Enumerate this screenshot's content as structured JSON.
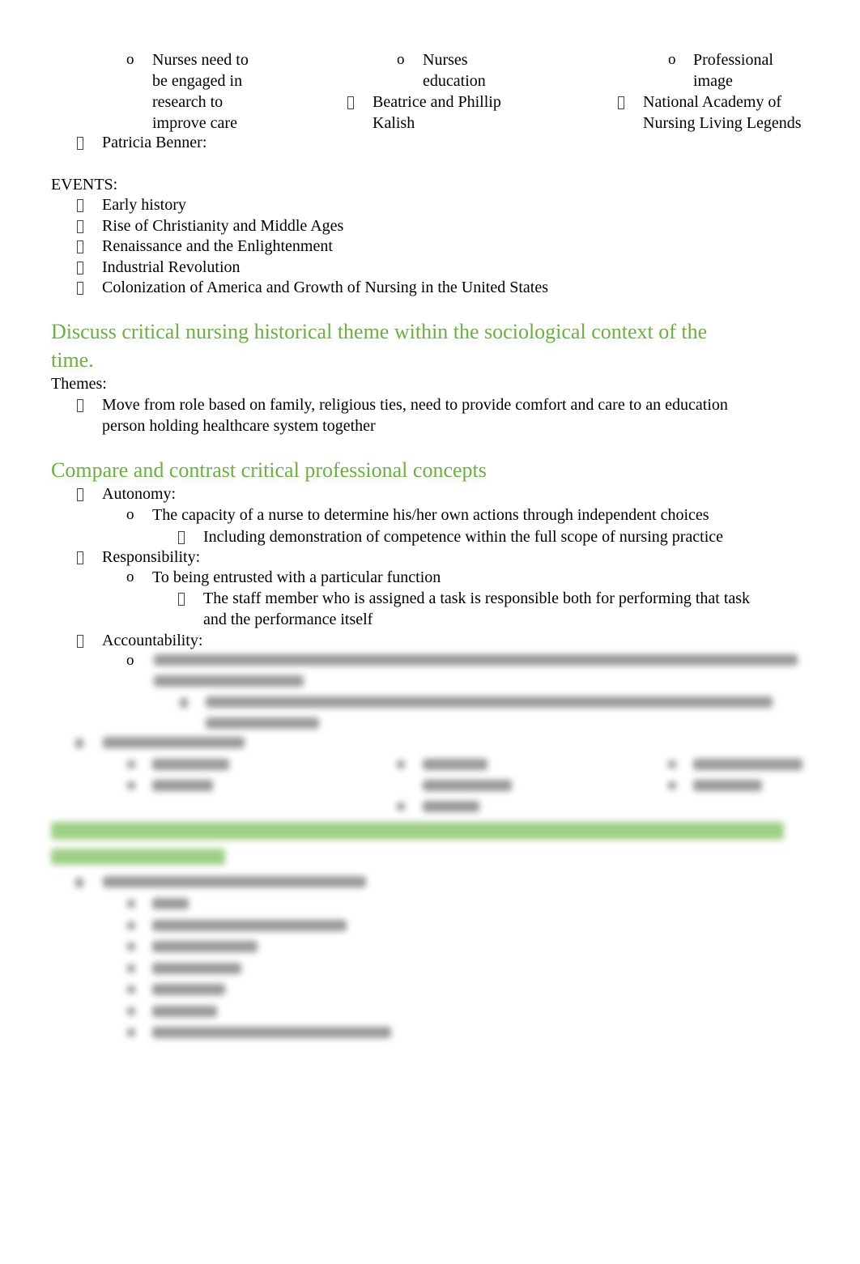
{
  "bullet_glyph": "square-missing-glyph",
  "heading_color": "#70ad47",
  "top_columns": {
    "col1_sub": [
      "Nurses need to",
      "be engaged in",
      "research to",
      "improve care"
    ],
    "col2_sub": [
      "Nurses",
      "education"
    ],
    "col2_item": [
      "Beatrice and Phillip",
      "Kalish"
    ],
    "col3_sub": [
      "Professional",
      "image"
    ],
    "col3_item": [
      "National Academy of",
      "Nursing Living Legends"
    ],
    "sub_marker": "o",
    "patricia": "Patricia Benner:"
  },
  "events": {
    "label": "EVENTS:",
    "items": [
      "Early history",
      "Rise of Christianity and Middle Ages",
      "Renaissance and the Enlightenment",
      "Industrial Revolution",
      "Colonization of America and Growth of Nursing in the United States"
    ]
  },
  "section1": {
    "heading": [
      "Discuss critical nursing historical theme within the sociological context of the",
      "time."
    ],
    "label": "Themes:",
    "item": [
      "Move from role based on family, religious ties, need to provide comfort and care to an education",
      "person holding healthcare system together"
    ]
  },
  "section2": {
    "heading": "Compare and contrast critical professional concepts",
    "autonomy": "Autonomy:",
    "autonomy_sub": "The capacity of a nurse to determine his/her own actions through independent choices",
    "autonomy_sub2": "Including demonstration of competence within the full scope of nursing practice",
    "responsibility": "Responsibility:",
    "responsibility_sub": "To being entrusted with a particular function",
    "responsibility_sub2": [
      "The staff member who is assigned a task is responsible  both for performing that task",
      "and the performance itself"
    ],
    "accountability": "Accountability:"
  }
}
